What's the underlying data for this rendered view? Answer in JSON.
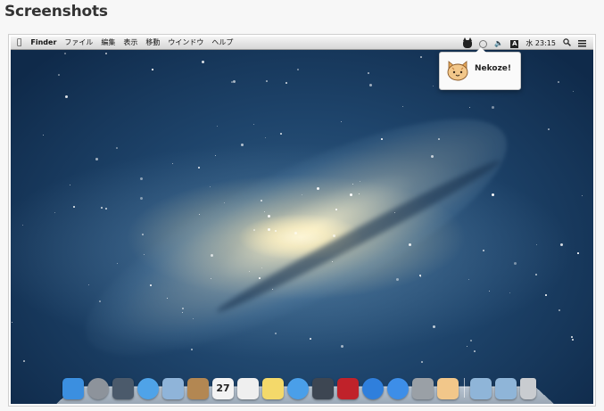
{
  "section_heading": "Screenshots",
  "menubar": {
    "apple": "",
    "items": [
      "Finder",
      "ファイル",
      "編集",
      "表示",
      "移動",
      "ウインドウ",
      "ヘルプ"
    ],
    "input_source": "A",
    "clock": "水 23:15"
  },
  "popup": {
    "label": "Nekoze!"
  },
  "dock": {
    "apps": [
      {
        "name": "finder-icon",
        "color": "#3b8fe0"
      },
      {
        "name": "launchpad-icon",
        "color": "#8d939b"
      },
      {
        "name": "mission-control-icon",
        "color": "#4b5a6b"
      },
      {
        "name": "safari-icon",
        "color": "#4fa3e8"
      },
      {
        "name": "mail-icon",
        "color": "#8fb4d9"
      },
      {
        "name": "contacts-icon",
        "color": "#b38752"
      },
      {
        "name": "calendar-icon",
        "color": "#f3f3f3",
        "text": "27"
      },
      {
        "name": "reminders-icon",
        "color": "#efefef"
      },
      {
        "name": "notes-icon",
        "color": "#f4d96a"
      },
      {
        "name": "messages-icon",
        "color": "#4a9fe9"
      },
      {
        "name": "facetime-icon",
        "color": "#3d4652"
      },
      {
        "name": "photo-booth-icon",
        "color": "#c0222a"
      },
      {
        "name": "itunes-icon",
        "color": "#2f7fdc"
      },
      {
        "name": "app-store-icon",
        "color": "#3d8ee8"
      },
      {
        "name": "system-preferences-icon",
        "color": "#9aa0a6"
      },
      {
        "name": "nekoze-icon",
        "color": "#f2c78a"
      }
    ],
    "stacks": [
      {
        "name": "applications-folder-icon",
        "color": "#8fb5d8"
      },
      {
        "name": "downloads-folder-icon",
        "color": "#8fb5d8"
      },
      {
        "name": "trash-icon",
        "color": "#c9ccd0"
      }
    ]
  }
}
